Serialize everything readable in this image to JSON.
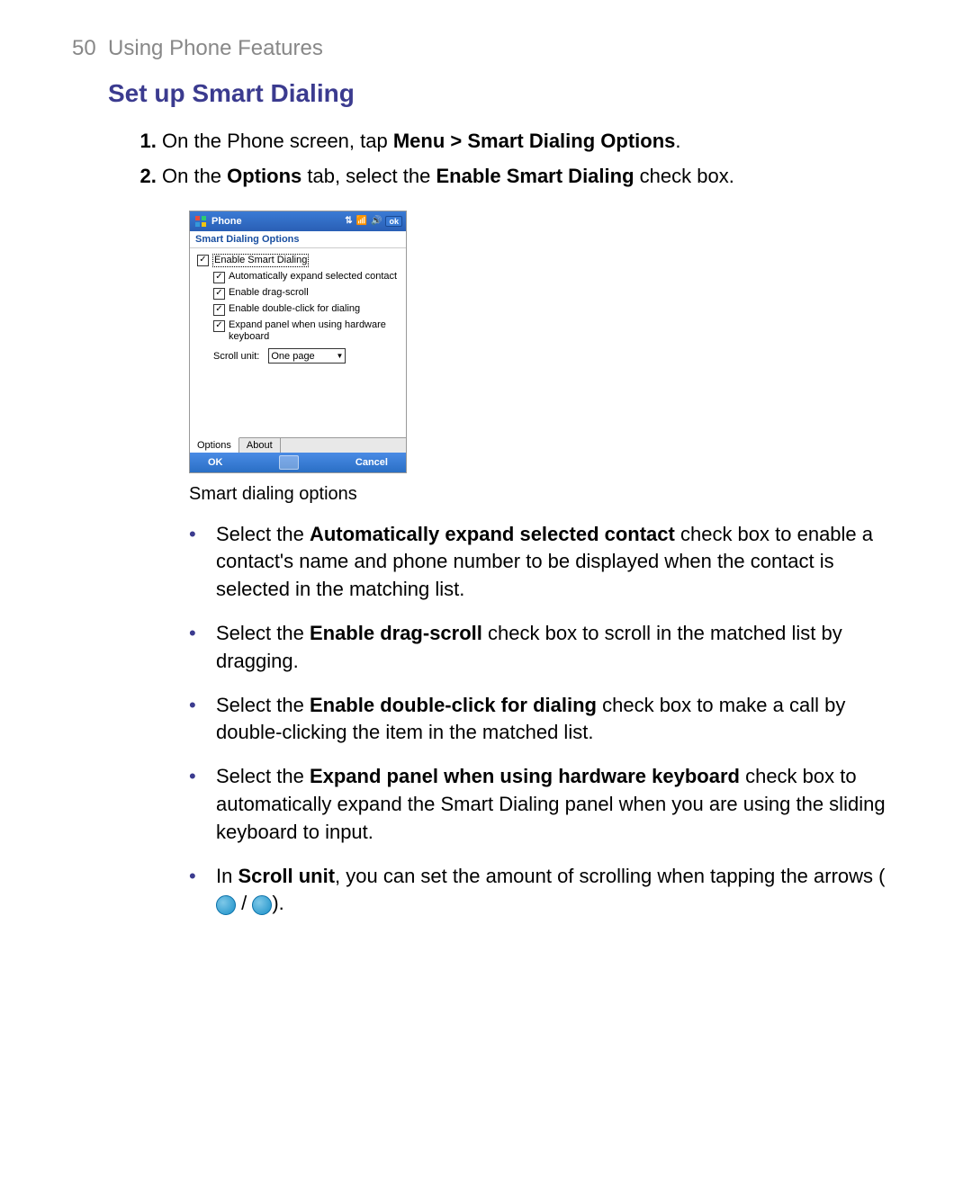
{
  "header": {
    "page_number": "50",
    "chapter": "Using Phone Features"
  },
  "section_title": "Set up Smart Dialing",
  "steps": {
    "s1": {
      "pre": "On the Phone screen, tap ",
      "bold": "Menu > Smart Dialing Options",
      "post": "."
    },
    "s2": {
      "pre": "On the ",
      "b1": "Options",
      "mid": " tab, select the ",
      "b2": "Enable Smart Dialing",
      "post": " check box."
    }
  },
  "device": {
    "title": "Phone",
    "ok_small": "ok",
    "panel_title": "Smart Dialing Options",
    "checks": {
      "c1": "Enable Smart Dialing",
      "c2": "Automatically expand selected contact",
      "c3": "Enable drag-scroll",
      "c4": "Enable double-click for dialing",
      "c5": "Expand panel when using hardware keyboard"
    },
    "scroll_label": "Scroll unit:",
    "scroll_value": "One page",
    "tabs": {
      "t1": "Options",
      "t2": "About"
    },
    "softkeys": {
      "left": "OK",
      "right": "Cancel"
    }
  },
  "caption": "Smart dialing options",
  "bullets": {
    "b1": {
      "pre": "Select the ",
      "bold": "Automatically expand selected contact",
      "post": " check box to enable a contact's name and phone number to be displayed when the contact is selected in the matching list."
    },
    "b2": {
      "pre": "Select the ",
      "bold": "Enable drag-scroll",
      "post": " check box to scroll in the matched list by dragging."
    },
    "b3": {
      "pre": "Select the ",
      "bold": "Enable double-click for dialing",
      "post": " check box to make a call by double-clicking the item in the matched list."
    },
    "b4": {
      "pre": "Select the ",
      "bold": "Expand panel when using hardware keyboard",
      "post": " check box to automatically expand the Smart Dialing panel when you are using the sliding keyboard to input."
    },
    "b5": {
      "pre": "In ",
      "bold": "Scroll unit",
      "post1": ", you can set the amount of scrolling when tapping the arrows (",
      "sep": " / ",
      "post2": ")."
    }
  }
}
